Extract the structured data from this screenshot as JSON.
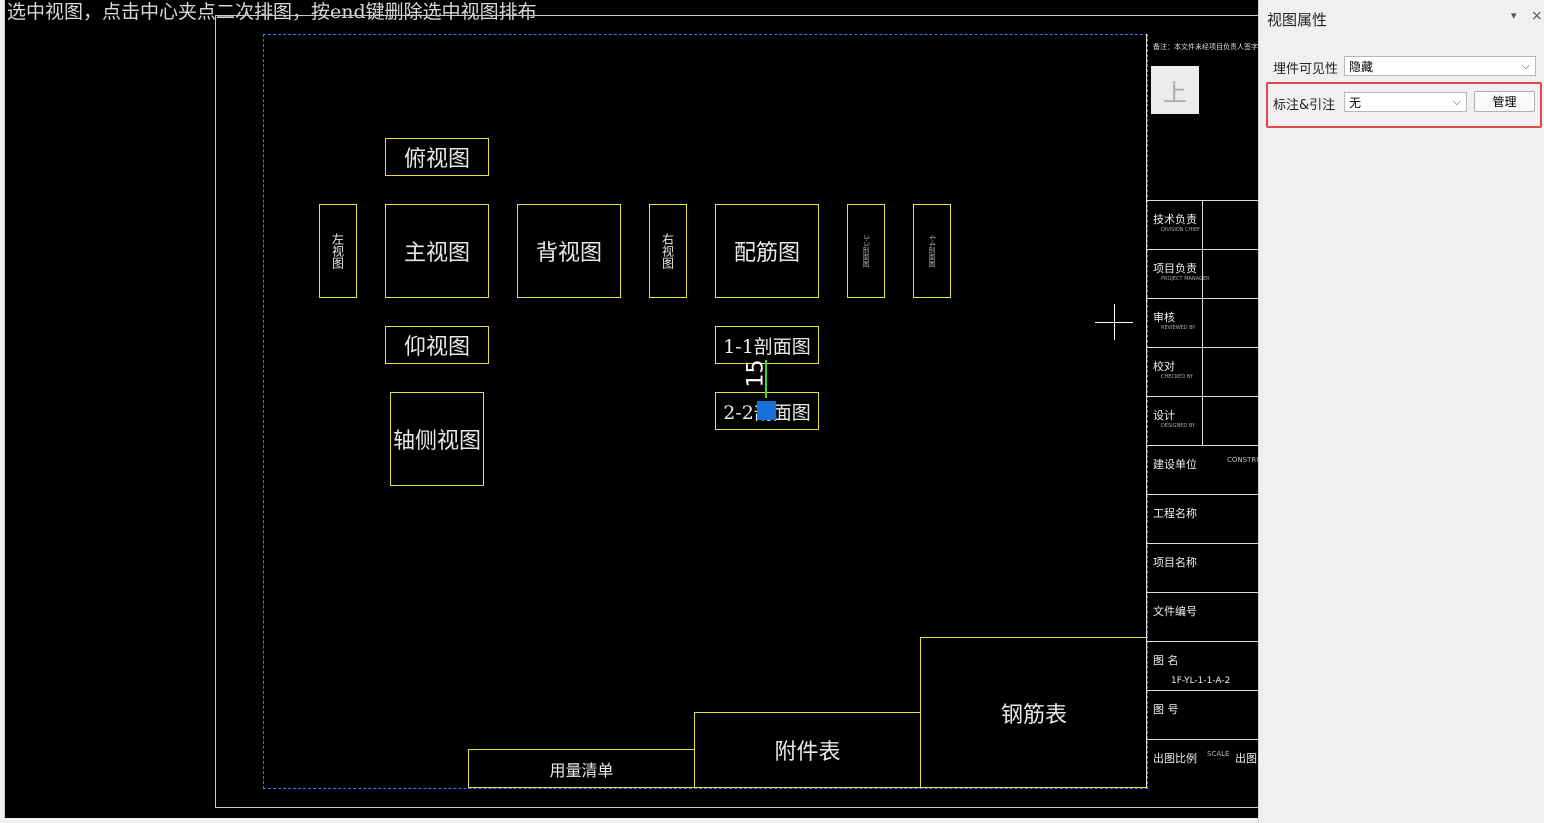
{
  "canvas": {
    "hint": "选中视图，点击中心夹点二次排图，按end键删除选中视图排布",
    "views": {
      "top_view": "俯视图",
      "left_view": "左视图",
      "main_view": "主视图",
      "back_view": "背视图",
      "right_view": "右视图",
      "rebar_view": "配筋图",
      "section_3": "3-3剖面图",
      "section_4": "4-4剖面图",
      "bottom_view": "仰视图",
      "section_1": "1-1剖面图",
      "section_2": "2-2剖面图",
      "axis_view": "轴侧视图"
    },
    "dimension": "15",
    "tables": {
      "usage_list": "用量清单",
      "attachment_table": "附件表",
      "rebar_table": "钢筋表"
    },
    "title_block": {
      "note": "备注：本文件未经项目负责人签字并未盖章",
      "logo": "上",
      "rows": [
        {
          "label": "技术负责",
          "sub": "DIVISION CHIEF"
        },
        {
          "label": "项目负责",
          "sub": "PROJECT MANAGER"
        },
        {
          "label": "审核",
          "sub": "REVIEWED BY"
        },
        {
          "label": "校对",
          "sub": "CHECKED BY"
        },
        {
          "label": "设计",
          "sub": "DESIGNED BY"
        },
        {
          "label": "建设单位",
          "side": "CONSTRU"
        },
        {
          "label": "工程名称"
        },
        {
          "label": "项目名称"
        },
        {
          "label": "文件编号"
        },
        {
          "label": "图  名",
          "value": "1F-YL-1-1-A-2"
        },
        {
          "label": "图  号"
        },
        {
          "label": "出图比例",
          "side": "SCALE",
          "extra": "出图日"
        }
      ]
    }
  },
  "panel": {
    "title": "视图属性",
    "pin": "▾",
    "close": "×",
    "embed_visibility_label": "埋件可见性",
    "embed_visibility_value": "隐藏",
    "annotation_label": "标注&引注",
    "annotation_value": "无",
    "manage_button": "管理"
  }
}
